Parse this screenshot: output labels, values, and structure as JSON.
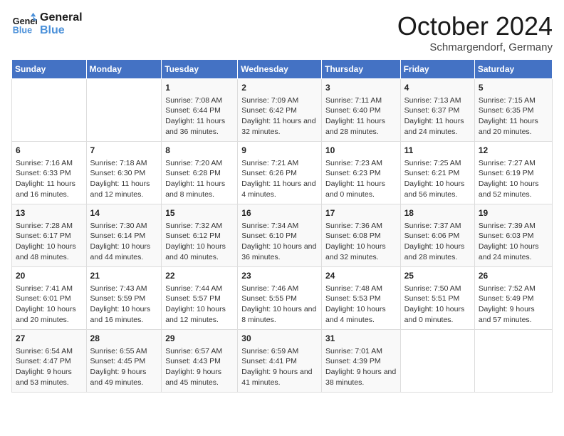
{
  "header": {
    "logo_line1": "General",
    "logo_line2": "Blue",
    "month": "October 2024",
    "location": "Schmargendorf, Germany"
  },
  "days_of_week": [
    "Sunday",
    "Monday",
    "Tuesday",
    "Wednesday",
    "Thursday",
    "Friday",
    "Saturday"
  ],
  "weeks": [
    [
      {
        "day": "",
        "content": ""
      },
      {
        "day": "",
        "content": ""
      },
      {
        "day": "1",
        "content": "Sunrise: 7:08 AM\nSunset: 6:44 PM\nDaylight: 11 hours and 36 minutes."
      },
      {
        "day": "2",
        "content": "Sunrise: 7:09 AM\nSunset: 6:42 PM\nDaylight: 11 hours and 32 minutes."
      },
      {
        "day": "3",
        "content": "Sunrise: 7:11 AM\nSunset: 6:40 PM\nDaylight: 11 hours and 28 minutes."
      },
      {
        "day": "4",
        "content": "Sunrise: 7:13 AM\nSunset: 6:37 PM\nDaylight: 11 hours and 24 minutes."
      },
      {
        "day": "5",
        "content": "Sunrise: 7:15 AM\nSunset: 6:35 PM\nDaylight: 11 hours and 20 minutes."
      }
    ],
    [
      {
        "day": "6",
        "content": "Sunrise: 7:16 AM\nSunset: 6:33 PM\nDaylight: 11 hours and 16 minutes."
      },
      {
        "day": "7",
        "content": "Sunrise: 7:18 AM\nSunset: 6:30 PM\nDaylight: 11 hours and 12 minutes."
      },
      {
        "day": "8",
        "content": "Sunrise: 7:20 AM\nSunset: 6:28 PM\nDaylight: 11 hours and 8 minutes."
      },
      {
        "day": "9",
        "content": "Sunrise: 7:21 AM\nSunset: 6:26 PM\nDaylight: 11 hours and 4 minutes."
      },
      {
        "day": "10",
        "content": "Sunrise: 7:23 AM\nSunset: 6:23 PM\nDaylight: 11 hours and 0 minutes."
      },
      {
        "day": "11",
        "content": "Sunrise: 7:25 AM\nSunset: 6:21 PM\nDaylight: 10 hours and 56 minutes."
      },
      {
        "day": "12",
        "content": "Sunrise: 7:27 AM\nSunset: 6:19 PM\nDaylight: 10 hours and 52 minutes."
      }
    ],
    [
      {
        "day": "13",
        "content": "Sunrise: 7:28 AM\nSunset: 6:17 PM\nDaylight: 10 hours and 48 minutes."
      },
      {
        "day": "14",
        "content": "Sunrise: 7:30 AM\nSunset: 6:14 PM\nDaylight: 10 hours and 44 minutes."
      },
      {
        "day": "15",
        "content": "Sunrise: 7:32 AM\nSunset: 6:12 PM\nDaylight: 10 hours and 40 minutes."
      },
      {
        "day": "16",
        "content": "Sunrise: 7:34 AM\nSunset: 6:10 PM\nDaylight: 10 hours and 36 minutes."
      },
      {
        "day": "17",
        "content": "Sunrise: 7:36 AM\nSunset: 6:08 PM\nDaylight: 10 hours and 32 minutes."
      },
      {
        "day": "18",
        "content": "Sunrise: 7:37 AM\nSunset: 6:06 PM\nDaylight: 10 hours and 28 minutes."
      },
      {
        "day": "19",
        "content": "Sunrise: 7:39 AM\nSunset: 6:03 PM\nDaylight: 10 hours and 24 minutes."
      }
    ],
    [
      {
        "day": "20",
        "content": "Sunrise: 7:41 AM\nSunset: 6:01 PM\nDaylight: 10 hours and 20 minutes."
      },
      {
        "day": "21",
        "content": "Sunrise: 7:43 AM\nSunset: 5:59 PM\nDaylight: 10 hours and 16 minutes."
      },
      {
        "day": "22",
        "content": "Sunrise: 7:44 AM\nSunset: 5:57 PM\nDaylight: 10 hours and 12 minutes."
      },
      {
        "day": "23",
        "content": "Sunrise: 7:46 AM\nSunset: 5:55 PM\nDaylight: 10 hours and 8 minutes."
      },
      {
        "day": "24",
        "content": "Sunrise: 7:48 AM\nSunset: 5:53 PM\nDaylight: 10 hours and 4 minutes."
      },
      {
        "day": "25",
        "content": "Sunrise: 7:50 AM\nSunset: 5:51 PM\nDaylight: 10 hours and 0 minutes."
      },
      {
        "day": "26",
        "content": "Sunrise: 7:52 AM\nSunset: 5:49 PM\nDaylight: 9 hours and 57 minutes."
      }
    ],
    [
      {
        "day": "27",
        "content": "Sunrise: 6:54 AM\nSunset: 4:47 PM\nDaylight: 9 hours and 53 minutes."
      },
      {
        "day": "28",
        "content": "Sunrise: 6:55 AM\nSunset: 4:45 PM\nDaylight: 9 hours and 49 minutes."
      },
      {
        "day": "29",
        "content": "Sunrise: 6:57 AM\nSunset: 4:43 PM\nDaylight: 9 hours and 45 minutes."
      },
      {
        "day": "30",
        "content": "Sunrise: 6:59 AM\nSunset: 4:41 PM\nDaylight: 9 hours and 41 minutes."
      },
      {
        "day": "31",
        "content": "Sunrise: 7:01 AM\nSunset: 4:39 PM\nDaylight: 9 hours and 38 minutes."
      },
      {
        "day": "",
        "content": ""
      },
      {
        "day": "",
        "content": ""
      }
    ]
  ]
}
